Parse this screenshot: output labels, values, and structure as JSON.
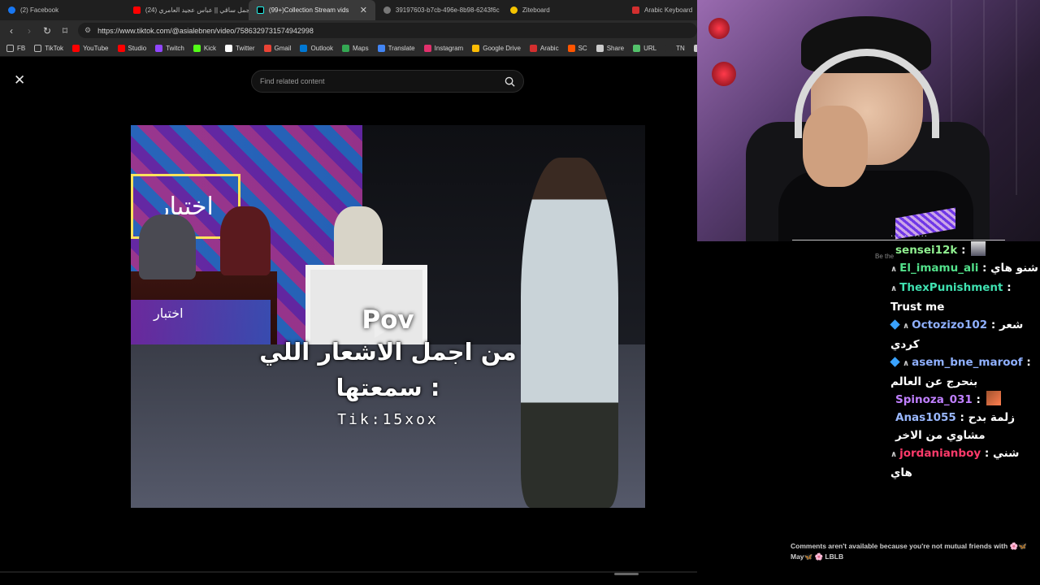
{
  "browser": {
    "tabs": [
      {
        "label": "(2) Facebook",
        "color": "#1877f2"
      },
      {
        "label": "(24) اجمل ساقي || عباس عجيد العامري",
        "color": "#ff0000"
      },
      {
        "label": "(99+)Collection Stream vids crea",
        "color": "#000000",
        "active": true
      },
      {
        "label": "39197603-b7cb-496e-8b98-6243f6c",
        "color": "#9e9e9e"
      },
      {
        "label": "Ziteboard",
        "color": "#f5c400"
      },
      {
        "label": "Arabic Keyboard",
        "color": "#d32f2f"
      }
    ],
    "url": "https://www.tiktok.com/@asialebnen/video/7586329731574942998",
    "bookmarks": [
      {
        "label": "FB",
        "icon": "folder-icon",
        "color": "#3a3a3a"
      },
      {
        "label": "TikTok",
        "icon": "folder-icon",
        "color": "#3a3a3a"
      },
      {
        "label": "YouTube",
        "icon": "youtube-icon",
        "color": "#ff0000"
      },
      {
        "label": "Studio",
        "icon": "youtube-studio-icon",
        "color": "#ff0000"
      },
      {
        "label": "Twitch",
        "icon": "twitch-icon",
        "color": "#9146ff"
      },
      {
        "label": "Kick",
        "icon": "kick-icon",
        "color": "#53fc18"
      },
      {
        "label": "Twitter",
        "icon": "x-icon",
        "color": "#ffffff"
      },
      {
        "label": "Gmail",
        "icon": "gmail-icon",
        "color": "#ea4335"
      },
      {
        "label": "Outlook",
        "icon": "outlook-icon",
        "color": "#0078d4"
      },
      {
        "label": "Maps",
        "icon": "maps-icon",
        "color": "#34a853"
      },
      {
        "label": "Translate",
        "icon": "translate-icon",
        "color": "#4285f4"
      },
      {
        "label": "Instagram",
        "icon": "instagram-icon",
        "color": "#e1306c"
      },
      {
        "label": "Google Drive",
        "icon": "drive-icon",
        "color": "#fbbc04"
      },
      {
        "label": "Arabic",
        "icon": "keyboard-icon",
        "color": "#d32f2f"
      },
      {
        "label": "SC",
        "icon": "sc-icon",
        "color": "#ff5500"
      },
      {
        "label": "Share",
        "icon": "share-icon",
        "color": "#cccccc"
      },
      {
        "label": "URL",
        "icon": "url-icon",
        "color": "#53c26b"
      },
      {
        "label": "TN",
        "icon": "tn-icon",
        "color": "#2b2b2b"
      },
      {
        "label": "Ch",
        "icon": "chrome-icon",
        "color": "#cccccc"
      }
    ]
  },
  "tiktok": {
    "search_placeholder": "Find related content",
    "video_text": {
      "pov": "Pov",
      "line1": "من اجمل الاشعار اللي",
      "line2": "سمعتها :",
      "tag": "Tik:15xox"
    },
    "comments_notice": "Comments aren't available because you're not mutual friends with 🌸🦋 May🦋 🌸 LBLB"
  },
  "chat": {
    "top_partial": "...........",
    "be_the": "Be the",
    "messages": [
      {
        "user": "sensei12k",
        "user_color": "#90f090",
        "text": "",
        "emote": true,
        "badge": "",
        "cube": false
      },
      {
        "user": "El_imamu_ali",
        "user_color": "#52e08a",
        "text": "شنو هاي",
        "badge": "∧",
        "cube": false
      },
      {
        "user": "ThexPunishment",
        "user_color": "#3fe0b0",
        "text": "Trust me",
        "badge": "∧",
        "cube": false
      },
      {
        "user": "Octozizo102",
        "user_color": "#8fb0ff",
        "text": "شعر كردي",
        "badge": "∧",
        "cube": true
      },
      {
        "user": "asem_bne_maroof",
        "user_color": "#8fb0ff",
        "text": "بنحرج عن العالم",
        "badge": "∧",
        "cube": true
      },
      {
        "user": "Spinoza_031",
        "user_color": "#c080ff",
        "text": "",
        "emote": true,
        "badge": "",
        "cube": false
      },
      {
        "user": "Anas1055",
        "user_color": "#9ab8ff",
        "text": "زلمة بدح مشاوي من الاخر",
        "badge": "",
        "cube": false
      },
      {
        "user": "jordanianboy",
        "user_color": "#ff3a6a",
        "text": "شني هاي",
        "badge": "∧",
        "cube": false
      }
    ]
  }
}
